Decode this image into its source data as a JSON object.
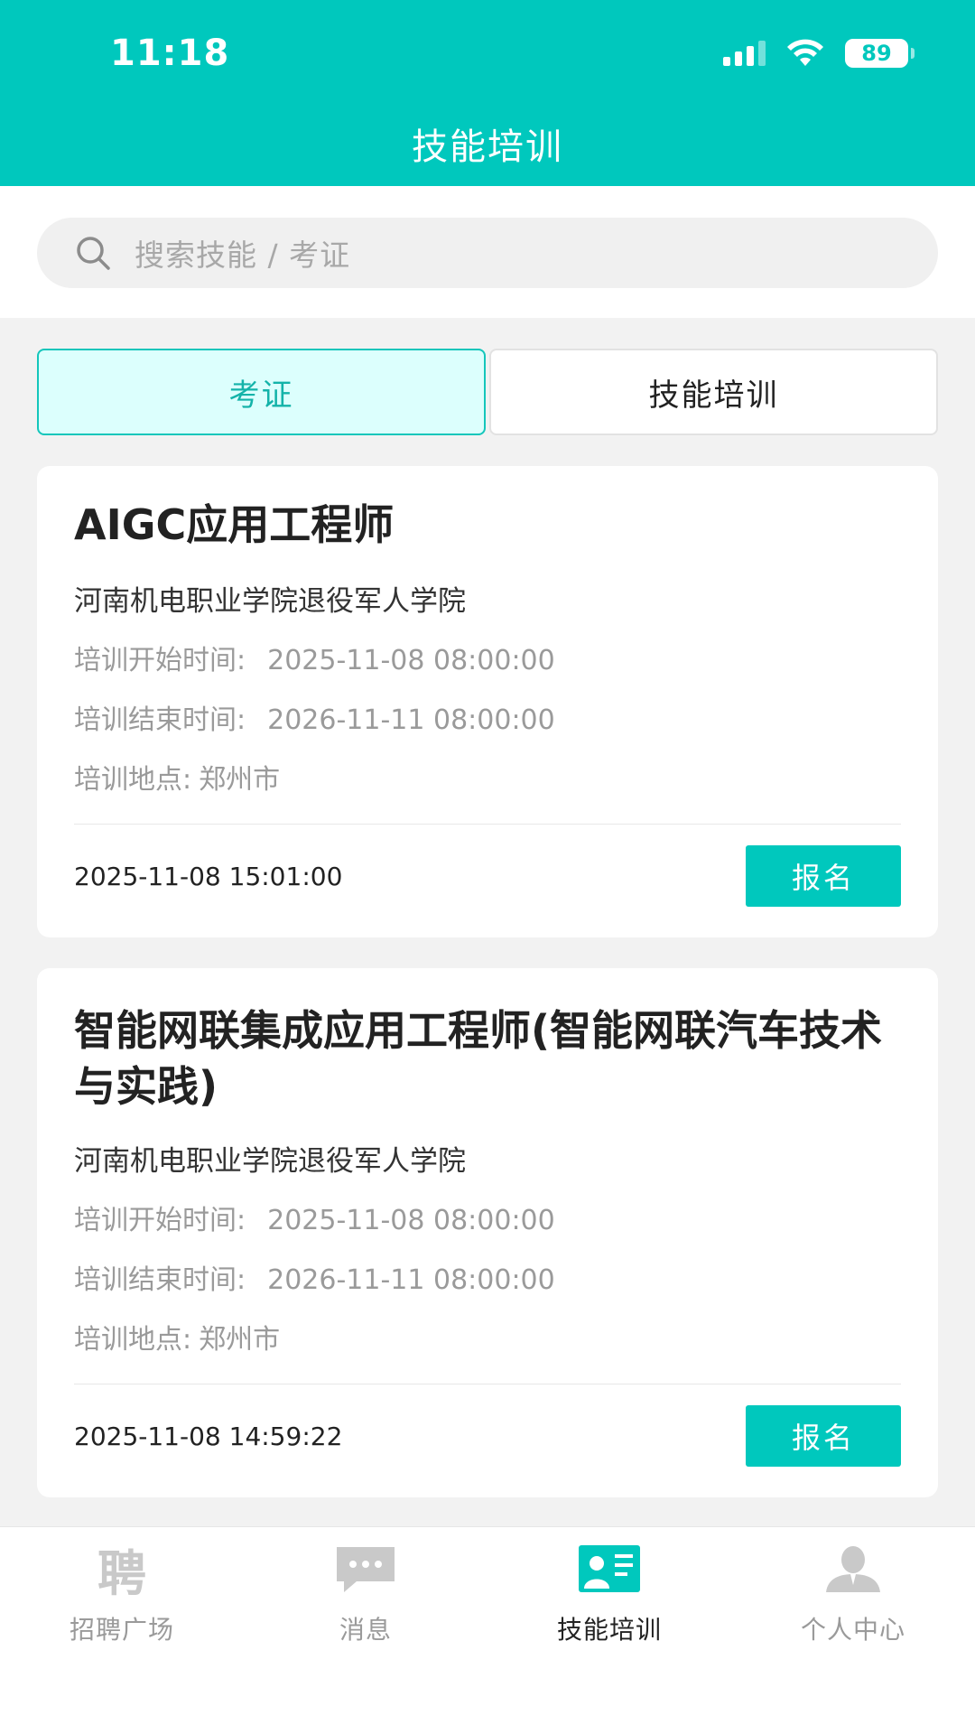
{
  "status_bar": {
    "time": "11:18",
    "battery": "89"
  },
  "header": {
    "title": "技能培训"
  },
  "search": {
    "placeholder": "搜索技能 / 考证"
  },
  "tabs": [
    {
      "label": "考证",
      "active": true
    },
    {
      "label": "技能培训",
      "active": false
    }
  ],
  "cards": [
    {
      "title": "AIGC应用工程师",
      "org": "河南机电职业学院退役军人学院",
      "start_label": "培训开始时间:",
      "start_value": "2025-11-08 08:00:00",
      "end_label": "培训结束时间:",
      "end_value": "2026-11-11 08:00:00",
      "location_label": "培训地点:",
      "location_value": "郑州市",
      "published": "2025-11-08 15:01:00",
      "button_label": "报名"
    },
    {
      "title": "智能网联集成应用工程师(智能网联汽车技术与实践)",
      "org": "河南机电职业学院退役军人学院",
      "start_label": "培训开始时间:",
      "start_value": "2025-11-08 08:00:00",
      "end_label": "培训结束时间:",
      "end_value": "2026-11-11 08:00:00",
      "location_label": "培训地点:",
      "location_value": "郑州市",
      "published": "2025-11-08 14:59:22",
      "button_label": "报名"
    }
  ],
  "bottom_nav": [
    {
      "label": "招聘广场",
      "icon": "recruit-icon",
      "icon_glyph": "聘",
      "active": false
    },
    {
      "label": "消息",
      "icon": "message-icon",
      "active": false
    },
    {
      "label": "技能培训",
      "icon": "training-icon",
      "active": true
    },
    {
      "label": "个人中心",
      "icon": "profile-icon",
      "active": false
    }
  ],
  "colors": {
    "primary": "#00c8bd",
    "tab_active_bg": "#dcfffd",
    "muted_text": "#9a9a9a"
  }
}
